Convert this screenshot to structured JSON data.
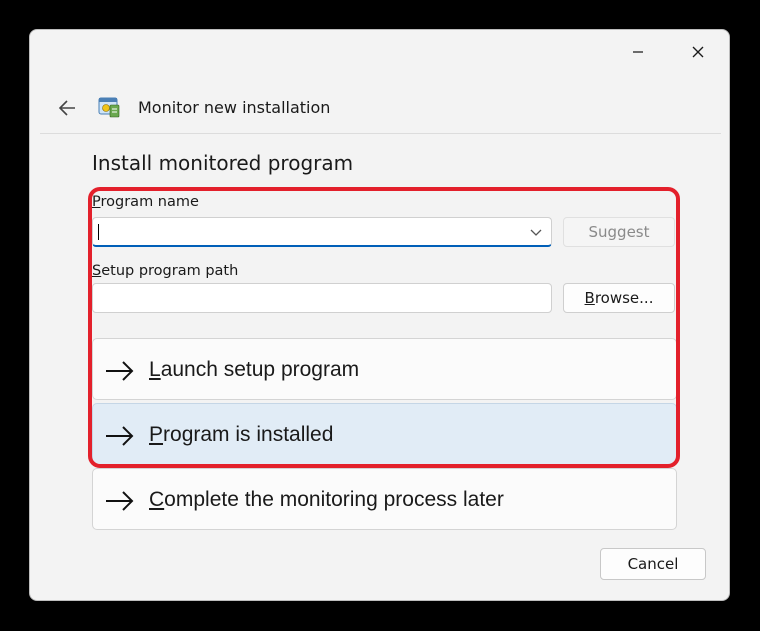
{
  "header": {
    "title": "Monitor new installation"
  },
  "section_title": "Install monitored program",
  "program_name": {
    "label_mnemonic": "P",
    "label_rest": "rogram name",
    "value": ""
  },
  "setup_path": {
    "label_mnemonic": "S",
    "label_rest": "etup program path",
    "value": ""
  },
  "buttons": {
    "suggest": "Suggest",
    "browse_mnemonic": "B",
    "browse_rest": "rowse...",
    "cancel": "Cancel"
  },
  "command_links": [
    {
      "mnemonic": "L",
      "rest": "aunch setup program"
    },
    {
      "mnemonic": "P",
      "rest": "rogram is installed"
    },
    {
      "mnemonic": "C",
      "rest": "omplete the monitoring process later"
    }
  ],
  "icons": {
    "minimize": "minimize-icon",
    "close": "close-icon",
    "back": "back-arrow-icon",
    "app": "installation-monitor-icon",
    "dropdown": "chevron-down-icon",
    "command": "arrow-right-icon"
  },
  "colors": {
    "highlight": "#e3202b",
    "accent": "#005fb8",
    "selected_link": "#e1ecf6"
  }
}
